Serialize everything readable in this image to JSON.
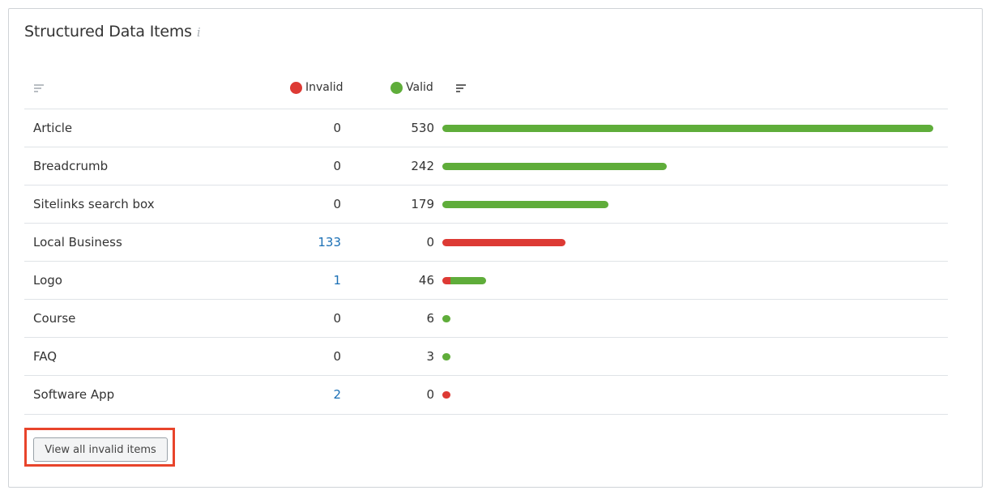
{
  "widget": {
    "title": "Structured Data Items",
    "info_glyph": "i",
    "colors": {
      "invalid": "#dd3a34",
      "valid": "#5fad3a",
      "link": "#1a6fb5",
      "highlight": "#e8442b"
    },
    "columns": {
      "invalid": "Invalid",
      "valid": "Valid"
    },
    "rows": [
      {
        "name": "Article",
        "invalid": "0",
        "valid": "530",
        "inv_n": 0,
        "val_n": 530
      },
      {
        "name": "Breadcrumb",
        "invalid": "0",
        "valid": "242",
        "inv_n": 0,
        "val_n": 242
      },
      {
        "name": "Sitelinks search box",
        "invalid": "0",
        "valid": "179",
        "inv_n": 0,
        "val_n": 179
      },
      {
        "name": "Local Business",
        "invalid": "133",
        "valid": "0",
        "inv_n": 133,
        "val_n": 0
      },
      {
        "name": "Logo",
        "invalid": "1",
        "valid": "46",
        "inv_n": 1,
        "val_n": 46
      },
      {
        "name": "Course",
        "invalid": "0",
        "valid": "6",
        "inv_n": 0,
        "val_n": 6
      },
      {
        "name": "FAQ",
        "invalid": "0",
        "valid": "3",
        "inv_n": 0,
        "val_n": 3
      },
      {
        "name": "Software App",
        "invalid": "2",
        "valid": "0",
        "inv_n": 2,
        "val_n": 0
      }
    ],
    "view_all_button": "View all invalid items"
  }
}
